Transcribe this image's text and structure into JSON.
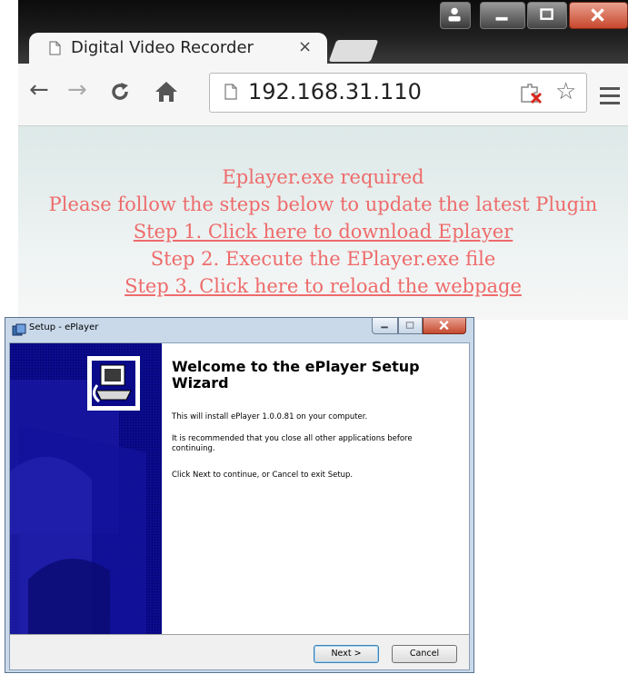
{
  "browser": {
    "tab_title": "Digital Video Recorder",
    "tab_close": "×",
    "url": "192.168.31.110"
  },
  "page": {
    "line1": "Eplayer.exe required",
    "line2": "Please follow the steps below to update the latest Plugin",
    "step1": "Step 1. Click here to download Eplayer",
    "step2": "Step 2. Execute the EPlayer.exe file",
    "step3": "Step 3. Click here to reload the webpage",
    "text_color": "#ee6b6b"
  },
  "setup": {
    "window_title": "Setup - ePlayer",
    "heading": "Welcome to the ePlayer Setup Wizard",
    "p1": "This will install ePlayer 1.0.0.81 on your computer.",
    "p2": "It is recommended that you close all other applications before continuing.",
    "p3": "Click Next to continue, or Cancel to exit Setup.",
    "next_label": "Next >",
    "cancel_label": "Cancel",
    "panel_color": "#0a0a8a"
  },
  "icons": [
    "page-icon",
    "close-icon",
    "back-icon",
    "forward-icon",
    "reload-icon",
    "home-icon",
    "plugin-blocked-icon",
    "star-icon",
    "menu-icon",
    "user-icon",
    "minimize-icon",
    "maximize-icon",
    "setup-app-icon",
    "installer-icon"
  ]
}
